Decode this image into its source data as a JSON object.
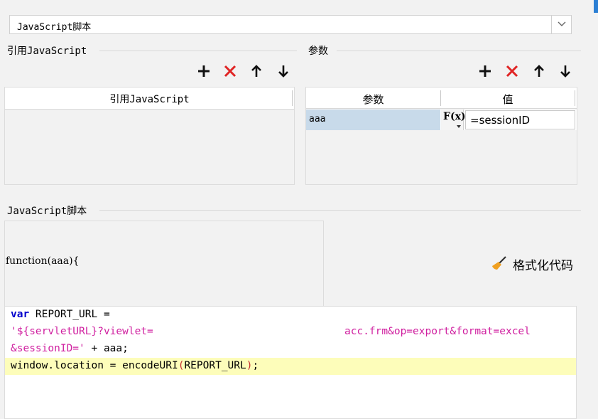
{
  "dropdown": {
    "value": "JavaScript脚本"
  },
  "left_section": {
    "title": "引用JavaScript",
    "column_header": "引用JavaScript"
  },
  "right_section": {
    "title": "参数",
    "columns": [
      "参数",
      "值"
    ],
    "rows": [
      {
        "name": "aaa",
        "formula_icon": "F(x)",
        "value": "=sessionID"
      }
    ]
  },
  "script_section": {
    "title": "JavaScript脚本",
    "function_signature": "function(aaa){",
    "format_button": "格式化代码"
  },
  "code": {
    "line1_kw": "var",
    "line1_rest": " REPORT_URL =",
    "line2_str_a": "'${servletURL}?viewlet=",
    "line2_str_b": "acc.frm&op=export&format=excel",
    "line3_str": "&sessionID='",
    "line3_rest": " + aaa;",
    "line4_a": "window.location = encodeURI",
    "line4_lp": "(",
    "line4_mid": "REPORT_URL",
    "line4_rp": ")",
    "line4_end": ";"
  },
  "colors": {
    "accent_red": "#e02424",
    "keyword": "#0000cc",
    "string": "#d020a0",
    "selected_row": "#c8daea",
    "highlight_line": "#fdfdba"
  }
}
